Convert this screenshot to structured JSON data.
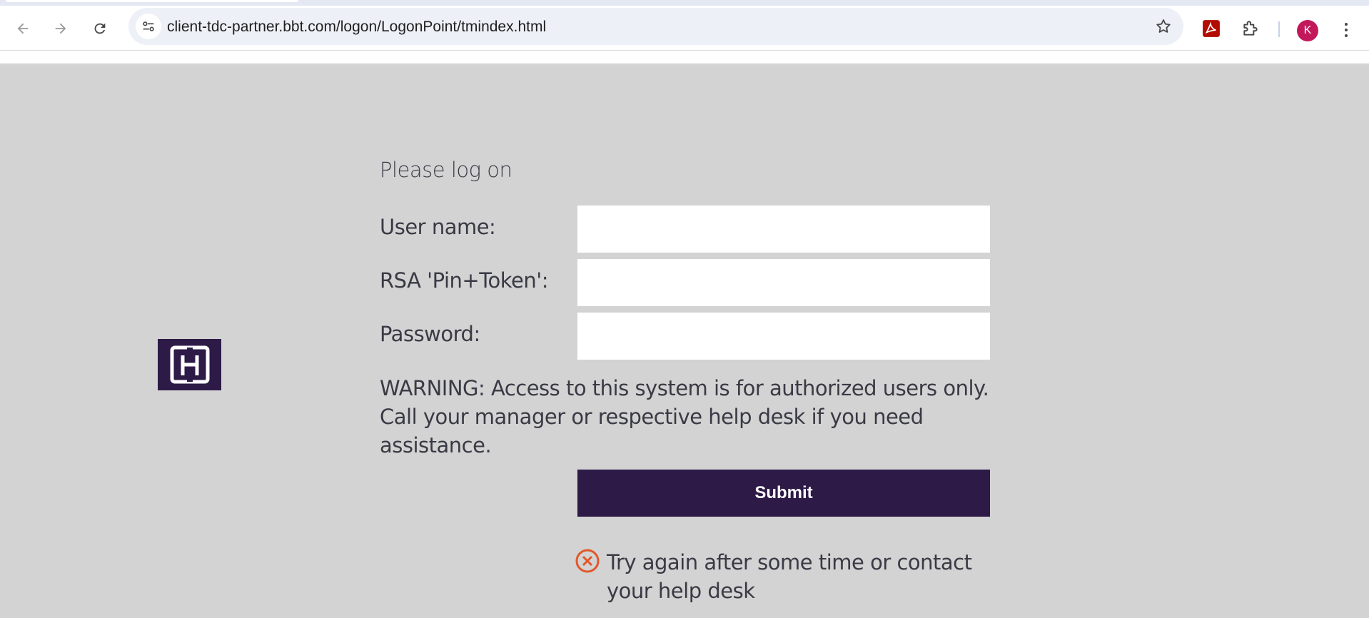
{
  "browser": {
    "url": "client-tdc-partner.bbt.com/logon/LogonPoint/tmindex.html",
    "avatar_letter": "K",
    "avatar_color": "#c2185b",
    "icons": {
      "back": "arrow-left-icon",
      "forward": "arrow-right-icon",
      "reload": "reload-icon",
      "site_info": "tune-icon",
      "bookmark": "star-icon",
      "pdf_extension": "acrobat-icon",
      "extensions": "puzzle-icon",
      "menu": "more-vert-icon"
    }
  },
  "page": {
    "background": "#d3d3d3",
    "brand_color": "#2d1a47",
    "logo_icon": "brand-logo-icon",
    "heading": "Please log on",
    "fields": {
      "username_label": "User name:",
      "username_value": "",
      "token_label": "RSA 'Pin+Token':",
      "token_value": "",
      "password_label": "Password:",
      "password_value": ""
    },
    "warning": "WARNING: Access to this system is for authorized users only. Call your manager or respective help desk if you need assistance.",
    "submit_label": "Submit",
    "error": {
      "icon": "error-circle-icon",
      "color": "#e2572b",
      "message": "Try again after some time or contact your help desk"
    }
  }
}
